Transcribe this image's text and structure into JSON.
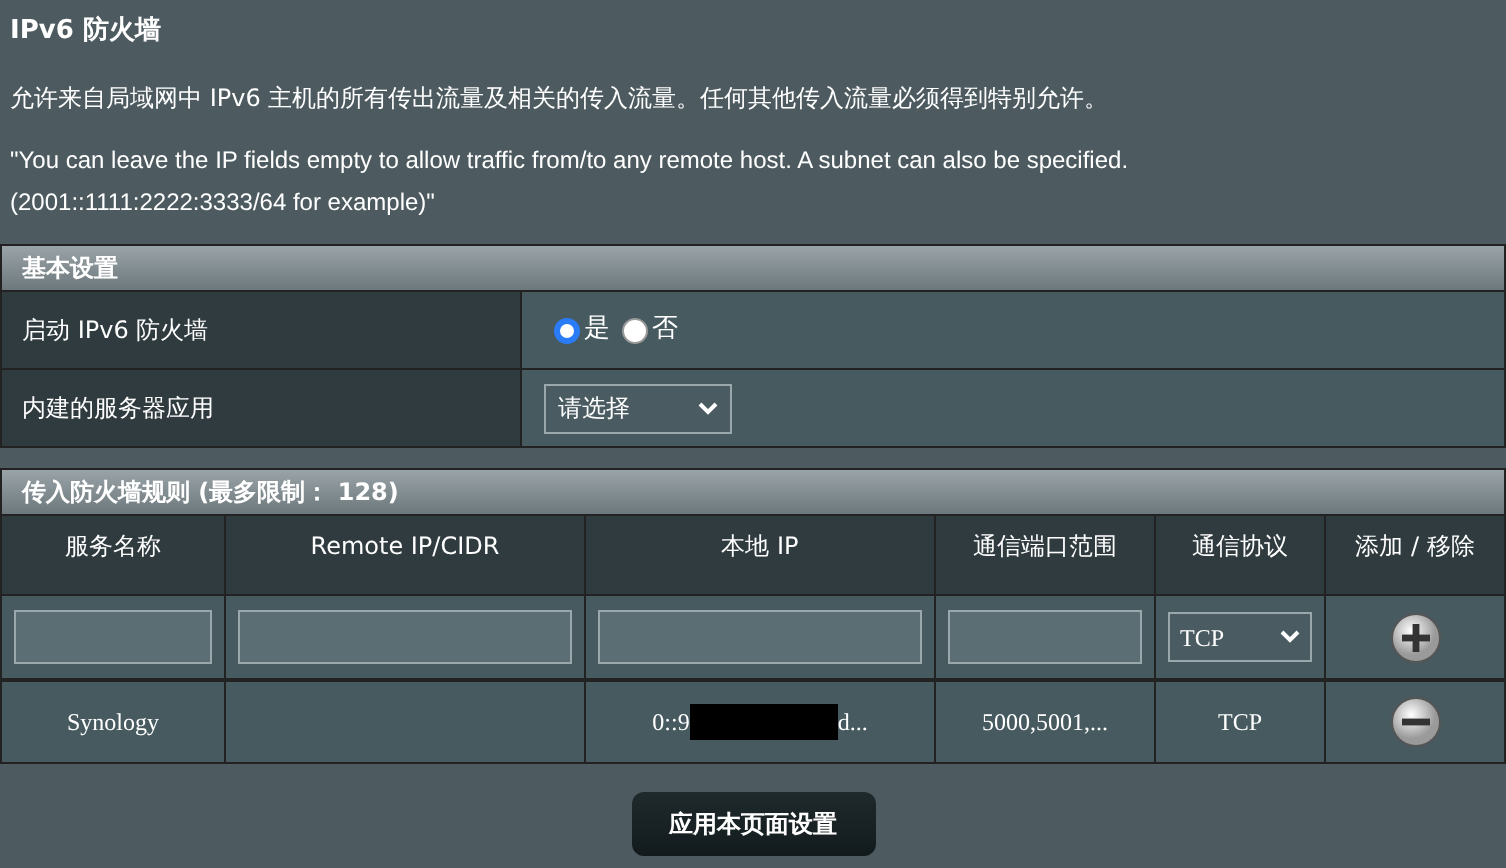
{
  "title": "IPv6 防火墙",
  "description": "允许来自局域网中 IPv6 主机的所有传出流量及相关的传入流量。任何其他传入流量必须得到特别允许。",
  "note": "\"You can leave the IP fields empty to allow traffic from/to any remote host. A subnet can also be specified. (2001::1111:2222:3333/64 for example)\"",
  "basic": {
    "header": "基本设置",
    "enable_label": "启动 IPv6 防火墙",
    "enable_options": [
      {
        "label": "是",
        "selected": true
      },
      {
        "label": "否",
        "selected": false
      }
    ],
    "server_label": "内建的服务器应用",
    "server_select": "请选择"
  },
  "rules": {
    "header": "传入防火墙规则 (最多限制： 128)",
    "columns": [
      "服务名称",
      "Remote IP/CIDR",
      "本地 IP",
      "通信端口范围",
      "通信协议",
      "添加 / 移除"
    ],
    "new_protocol": "TCP",
    "rows": [
      {
        "service": "Synology",
        "remote_ip": "",
        "local_ip_start": "0::9",
        "local_ip_end": "d...",
        "ports": "5000,5001,...",
        "protocol": "TCP",
        "redacted": true
      }
    ]
  },
  "apply_button": "应用本页面设置"
}
